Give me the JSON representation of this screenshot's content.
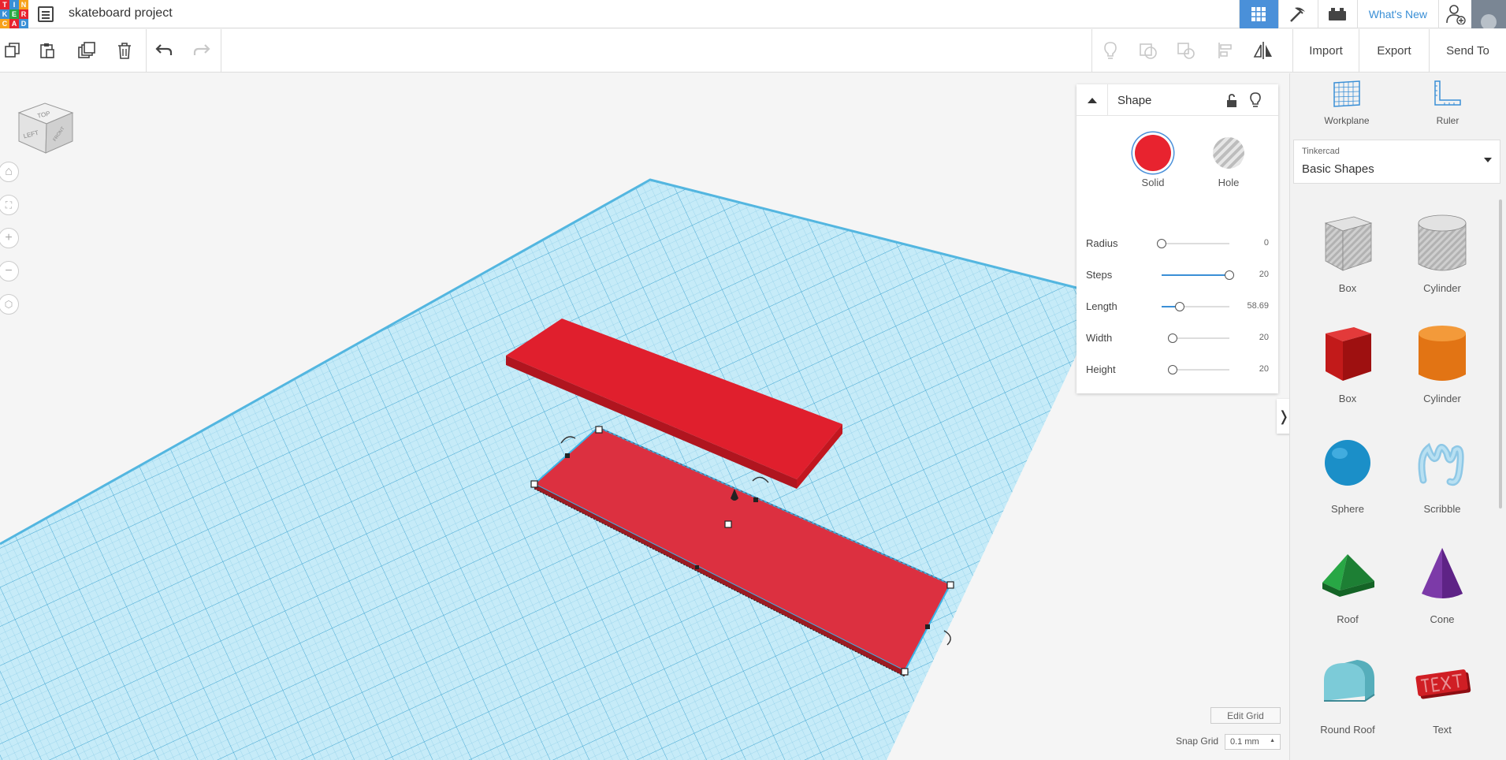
{
  "project": {
    "title": "skateboard project"
  },
  "logo": {
    "letters": [
      "T",
      "I",
      "N",
      "K",
      "E",
      "R",
      "C",
      "A",
      "D"
    ]
  },
  "topbar": {
    "whats_new": "What's New"
  },
  "toolbar": {
    "import_label": "Import",
    "export_label": "Export",
    "send_to_label": "Send To"
  },
  "navcube": {
    "top": "TOP",
    "left": "LEFT",
    "front": "FRONT"
  },
  "inspector": {
    "title": "Shape",
    "solid_label": "Solid",
    "hole_label": "Hole",
    "props": [
      {
        "name": "Radius",
        "value": "0",
        "level": 0.0
      },
      {
        "name": "Steps",
        "value": "20",
        "level": 1.0
      },
      {
        "name": "Length",
        "value": "58.69",
        "level": 0.27
      },
      {
        "name": "Width",
        "value": "20",
        "level": 0.0
      },
      {
        "name": "Height",
        "value": "20",
        "level": 0.0
      }
    ]
  },
  "grid": {
    "edit_label": "Edit Grid",
    "snap_label": "Snap Grid",
    "snap_value": "0.1 mm"
  },
  "panel": {
    "workplane_label": "Workplane",
    "ruler_label": "Ruler",
    "library_brand": "Tinkercad",
    "library_name": "Basic Shapes",
    "shapes": [
      "Box",
      "Cylinder",
      "Box",
      "Cylinder",
      "Sphere",
      "Scribble",
      "Roof",
      "Cone",
      "Round Roof",
      "Text"
    ]
  },
  "colors": {
    "accent": "#4a90d9",
    "solid_red": "#e8232f",
    "grid_blue": "#8fd3ee"
  }
}
